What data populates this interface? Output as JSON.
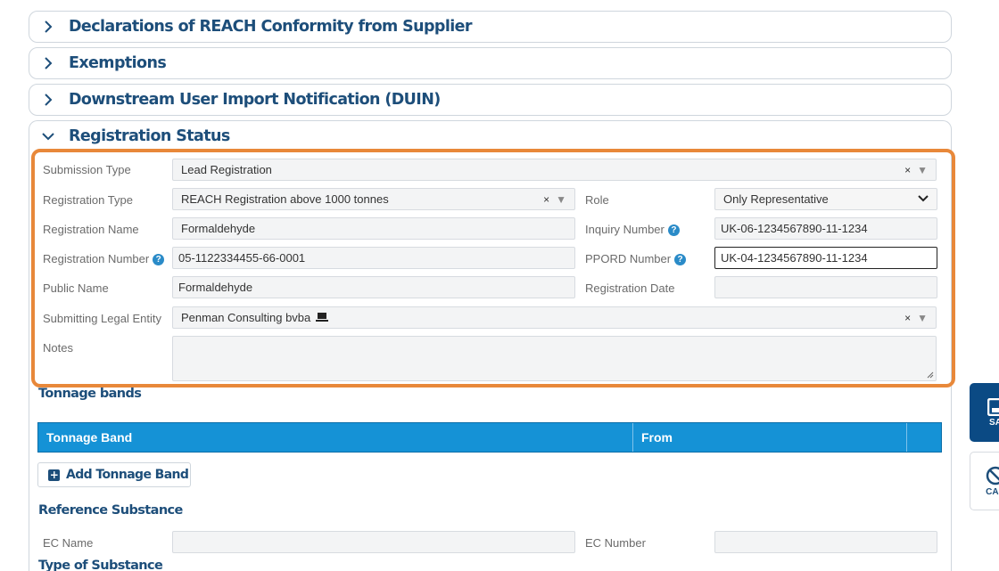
{
  "accordions": [
    {
      "title": "Declarations of REACH Conformity from Supplier",
      "expanded": false
    },
    {
      "title": "Exemptions",
      "expanded": false
    },
    {
      "title": "Downstream User Import Notification (DUIN)",
      "expanded": false
    },
    {
      "title": "Registration Status",
      "expanded": true
    }
  ],
  "registration": {
    "submission_type": {
      "label": "Submission Type",
      "value": "Lead Registration"
    },
    "registration_type": {
      "label": "Registration Type",
      "value": "REACH Registration above 1000 tonnes"
    },
    "role": {
      "label": "Role",
      "value": "Only Representative"
    },
    "registration_name": {
      "label": "Registration Name",
      "value": "Formaldehyde"
    },
    "inquiry_number": {
      "label": "Inquiry Number",
      "value": "UK-06-1234567890-11-1234"
    },
    "registration_number": {
      "label": "Registration Number",
      "value": "05-1122334455-66-0001"
    },
    "pppord_number": {
      "label": "PPORD Number",
      "value": "UK-04-1234567890-11-1234"
    },
    "public_name": {
      "label": "Public Name",
      "value": "Formaldehyde"
    },
    "registration_date": {
      "label": "Registration Date",
      "value": ""
    },
    "submitting_legal_entity": {
      "label": "Submitting Legal Entity",
      "value": "Penman Consulting bvba"
    },
    "notes": {
      "label": "Notes",
      "value": ""
    }
  },
  "tonnage": {
    "title": "Tonnage bands",
    "columns": [
      "Tonnage Band",
      "From",
      ""
    ],
    "add_button": "Add Tonnage Band"
  },
  "reference_substance": {
    "title": "Reference Substance",
    "ec_name": {
      "label": "EC Name",
      "value": ""
    },
    "ec_number": {
      "label": "EC Number",
      "value": ""
    }
  },
  "type_of_substance": {
    "title": "Type of Substance"
  },
  "side_actions": {
    "save": "SA",
    "cancel": "CAN"
  },
  "colors": {
    "accent": "#1592d6",
    "navy": "#1d4e7a",
    "highlight": "#e8883a"
  }
}
